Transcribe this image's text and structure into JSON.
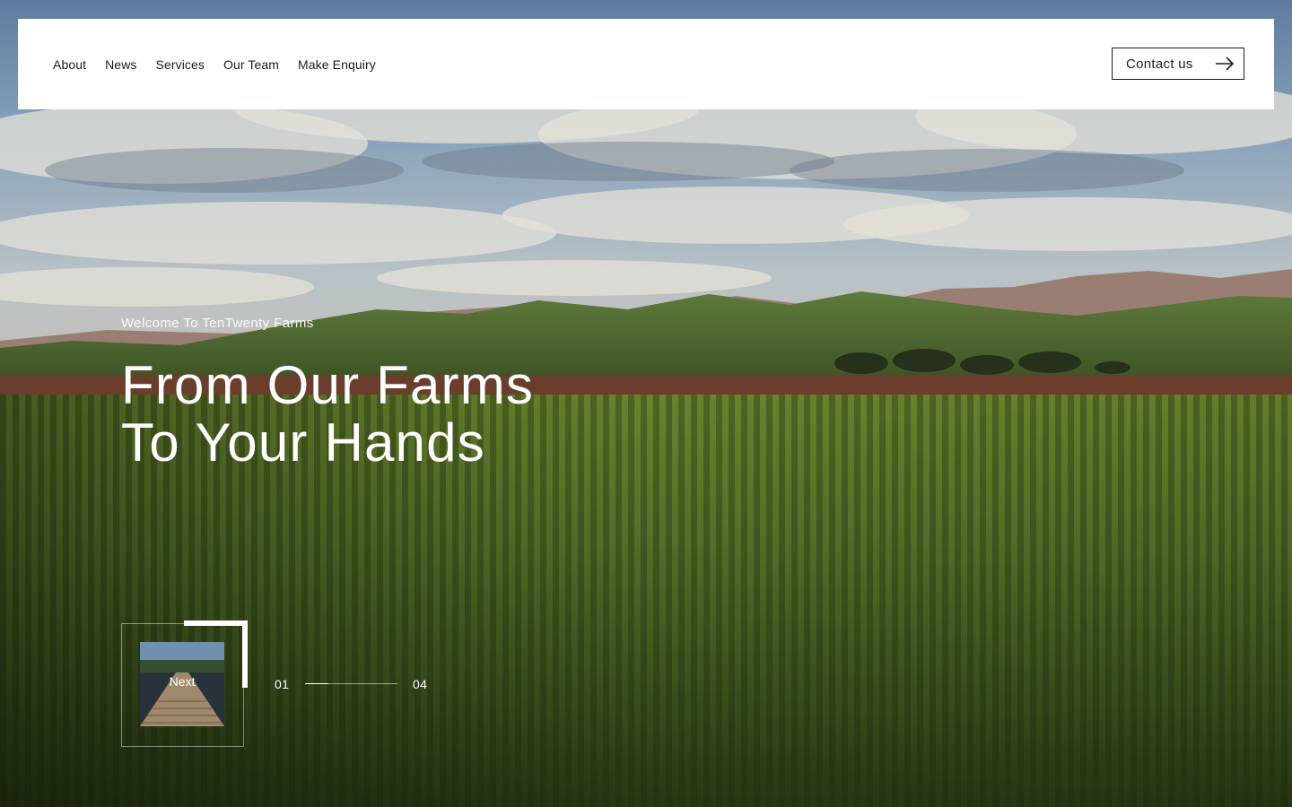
{
  "header": {
    "nav": [
      {
        "label": "About"
      },
      {
        "label": "News"
      },
      {
        "label": "Services"
      },
      {
        "label": "Our Team"
      },
      {
        "label": "Make Enquiry"
      }
    ],
    "contact_label": "Contact us",
    "contact_icon": "arrow-right-icon"
  },
  "hero": {
    "welcome": "Welcome To TenTwenty Farms",
    "headline_line1": "From Our Farms",
    "headline_line2": "To Your Hands",
    "background_icon": "farm-field-landscape"
  },
  "slider": {
    "next_label": "Next",
    "next_thumbnail": "boardwalk-thumbnail",
    "current": "01",
    "total": "04",
    "progress": 0.25
  },
  "colors": {
    "header_bg": "#ffffff",
    "text_dark": "#1c1c1c",
    "text_light": "#ffffff",
    "field_green": "#5d7a2a",
    "sky_blue": "#7a9bbd"
  }
}
